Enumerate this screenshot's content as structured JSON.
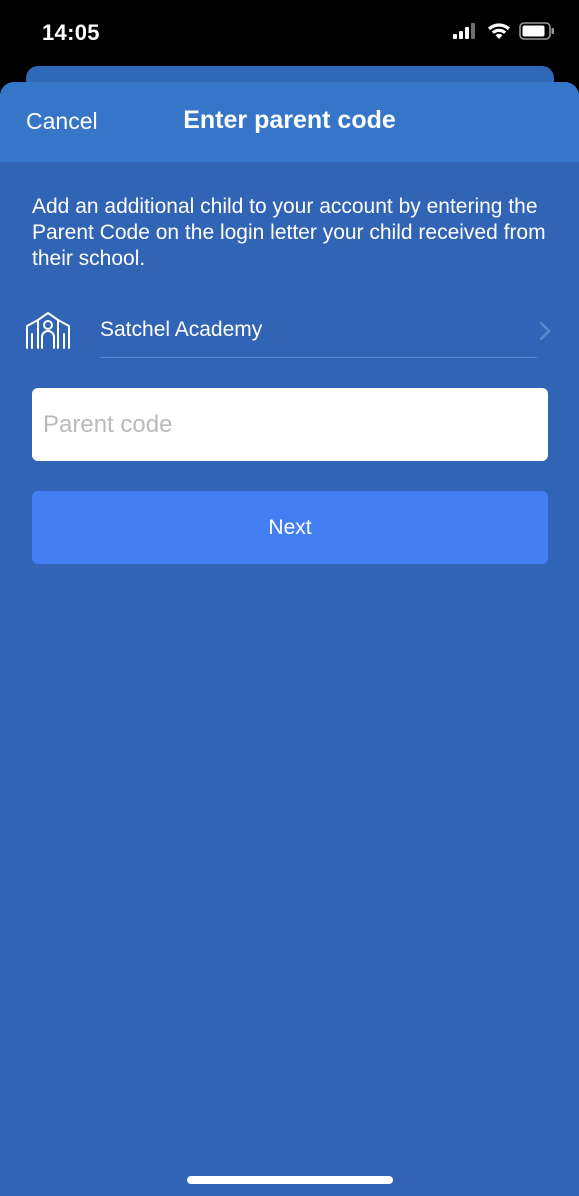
{
  "status_bar": {
    "time": "14:05",
    "icons": [
      "cellular-signal-icon",
      "wifi-icon",
      "battery-icon"
    ]
  },
  "nav": {
    "cancel_label": "Cancel",
    "title": "Enter parent code"
  },
  "description": "Add an additional child to your account by entering the Parent Code on the login letter your child received from their school.",
  "school": {
    "icon": "school-building-icon",
    "name": "Satchel Academy"
  },
  "parent_code": {
    "value": "",
    "placeholder": "Parent code"
  },
  "next_label": "Next",
  "colors": {
    "sheet_background": "#3164b4",
    "nav_background": "#3676c9",
    "button_accent": "#437ef3"
  }
}
